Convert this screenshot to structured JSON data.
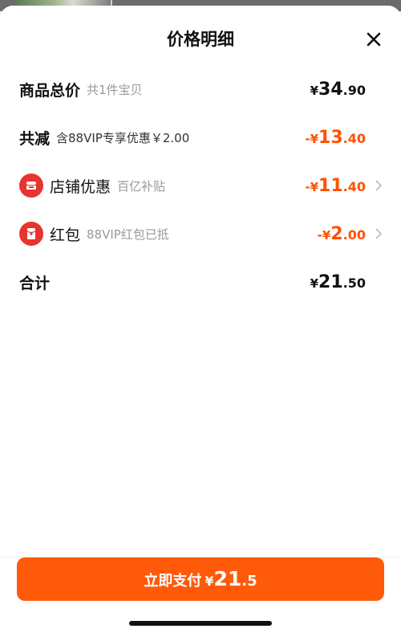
{
  "sheet": {
    "title": "价格明细"
  },
  "rows": {
    "goods_total": {
      "label": "商品总价",
      "sub": "共1件宝贝",
      "sign": "¥",
      "int": "34",
      "dec": ".90"
    },
    "total_reduce": {
      "label": "共减",
      "sub": "含88VIP专享优惠￥2.00",
      "sign": "-¥",
      "int": "13",
      "dec": ".40"
    },
    "shop_discount": {
      "label": "店铺优惠",
      "sub": "百亿补贴",
      "sign": "-¥",
      "int": "11",
      "dec": ".40"
    },
    "red_packet": {
      "label": "红包",
      "sub": "88VIP红包已抵",
      "sign": "-¥",
      "int": "2",
      "dec": ".00"
    },
    "sum": {
      "label": "合计",
      "sign": "¥",
      "int": "21",
      "dec": ".50"
    }
  },
  "pay_button": {
    "label": "立即支付",
    "sign": "¥",
    "int": "21",
    "dec": ".5"
  },
  "colors": {
    "accent": "#ff5000",
    "button": "#ff5a0a",
    "badge": "#e8342e"
  },
  "icons": {
    "close": "close-icon",
    "chevron": "chevron-right-icon",
    "shop": "shop-icon",
    "red_packet": "red-packet-icon"
  }
}
